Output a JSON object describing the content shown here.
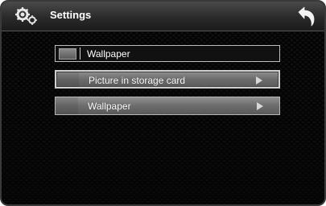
{
  "header": {
    "title": "Settings",
    "icon": "settings-gears-icon",
    "back_icon": "back-arrow-icon"
  },
  "section": {
    "title": "Wallpaper",
    "icon": "wallpaper-thumbnail-icon"
  },
  "options": [
    {
      "label": "Picture in storage card",
      "icon": "chevron-right-icon"
    },
    {
      "label": "Wallpaper",
      "icon": "chevron-right-icon"
    }
  ]
}
